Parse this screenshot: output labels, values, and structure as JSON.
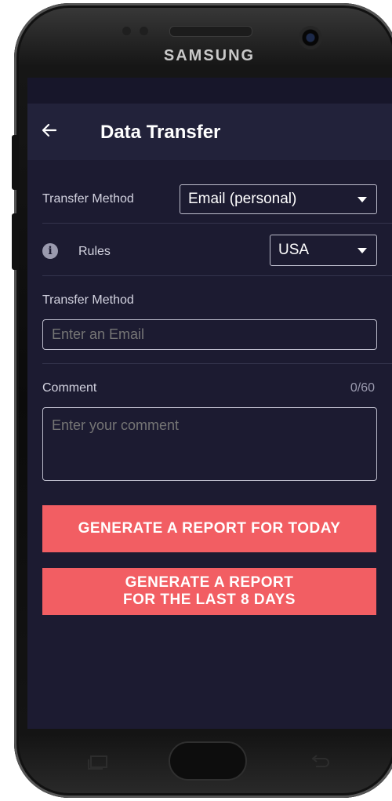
{
  "device": {
    "brand": "SAMSUNG"
  },
  "appbar": {
    "title": "Data Transfer",
    "back_icon": "arrow-left-icon"
  },
  "transfer_method_select": {
    "label": "Transfer Method",
    "value": "Email (personal)"
  },
  "rules_select": {
    "label": "Rules",
    "value": "USA",
    "icon": "info-icon"
  },
  "email_field": {
    "label": "Transfer Method",
    "placeholder": "Enter an Email"
  },
  "comment_field": {
    "label": "Comment",
    "counter": "0/60",
    "placeholder": "Enter your comment"
  },
  "buttons": {
    "report_today": "GENERATE A REPORT FOR TODAY",
    "report_last_8_line1": "GENERATE A REPORT",
    "report_last_8_line2": "FOR THE LAST 8 DAYS"
  },
  "colors": {
    "background": "#1c1b31",
    "appbar": "#22223a",
    "accent_button": "#f25e63",
    "border": "#bdbdcc"
  }
}
